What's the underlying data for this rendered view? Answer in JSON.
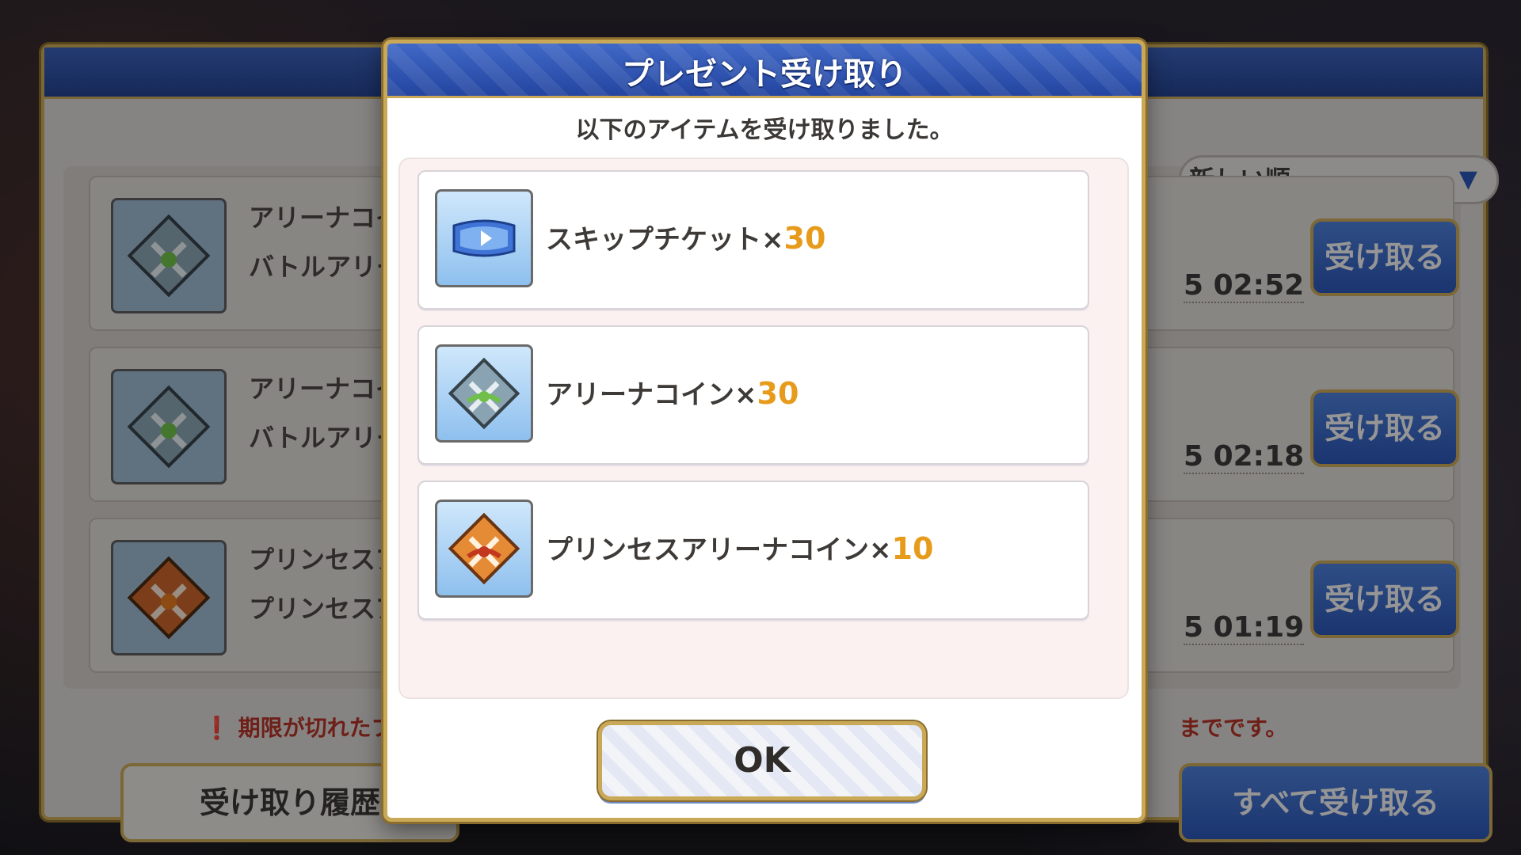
{
  "background": {
    "sort_label": "新しい順",
    "rows": [
      {
        "line1": "アリーナコイン",
        "line2": "バトルアリー",
        "time": "5 02:52",
        "button": "受け取る",
        "icon": "arena-coin-icon"
      },
      {
        "line1": "アリーナコイ",
        "line2": "バトルアリー",
        "time": "5 02:18",
        "button": "受け取る",
        "icon": "arena-coin-icon"
      },
      {
        "line1": "プリンセスア",
        "line2": "プリンセスア",
        "time": "5 01:19",
        "button": "受け取る",
        "icon": "princess-arena-coin-icon"
      }
    ],
    "notice_left": "期限が切れたプレ",
    "notice_right": "までです。",
    "history_button": "受け取り履歴",
    "receive_all_button": "すべて受け取る"
  },
  "dialog": {
    "title": "プレゼント受け取り",
    "message": "以下のアイテムを受け取りました。",
    "items": [
      {
        "name": "スキップチケット",
        "separator": "×",
        "quantity": "30",
        "icon": "skip-ticket-icon"
      },
      {
        "name": "アリーナコイン",
        "separator": "×",
        "quantity": "30",
        "icon": "arena-coin-icon"
      },
      {
        "name": "プリンセスアリーナコイン",
        "separator": "×",
        "quantity": "10",
        "icon": "princess-arena-coin-icon"
      }
    ],
    "ok_button": "OK"
  },
  "colors": {
    "header_blue": "#2d52ad",
    "gold_border": "#c9a957",
    "quantity_orange": "#e79b1b",
    "arena_coin_green": "#6fbf4a",
    "princess_coin_orange": "#e07a1f"
  }
}
